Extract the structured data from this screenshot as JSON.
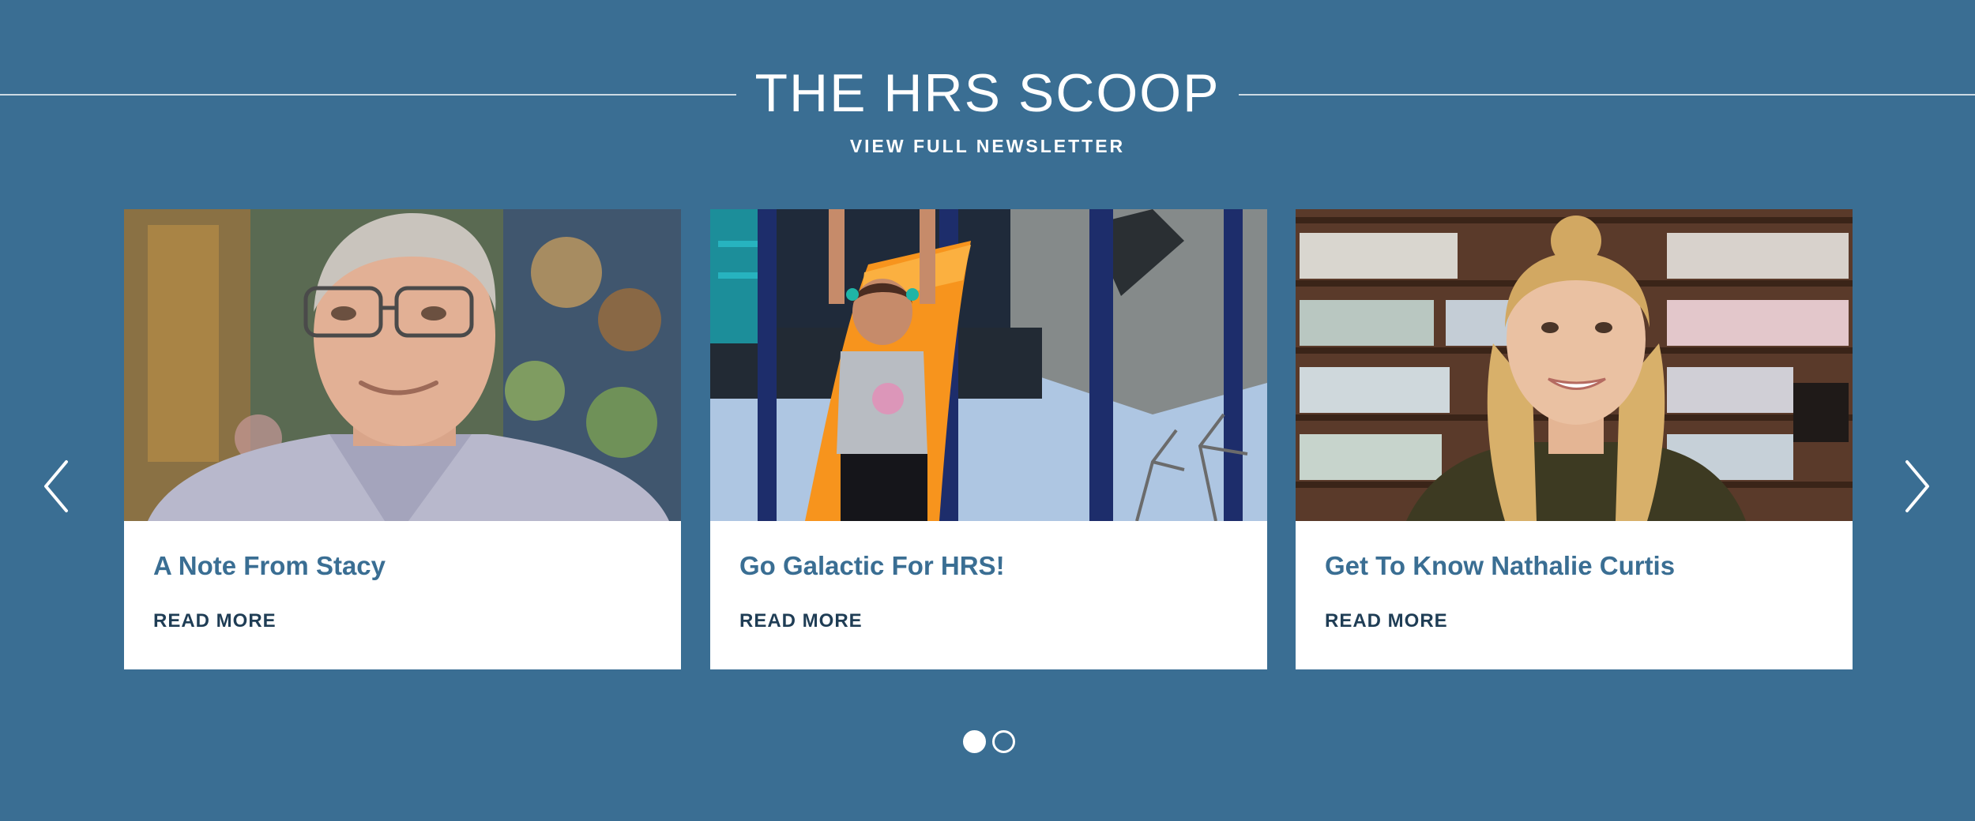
{
  "header": {
    "title": "THE HRS SCOOP",
    "newsletter_link": "VIEW FULL NEWSLETTER"
  },
  "carousel": {
    "prev_icon": "chevron-left-icon",
    "next_icon": "chevron-right-icon",
    "cards": [
      {
        "title": "A Note From Stacy",
        "read_more": "READ MORE",
        "image": "man-with-glasses-portrait"
      },
      {
        "title": "Go Galactic For HRS!",
        "read_more": "READ MORE",
        "image": "girl-on-playground-slide"
      },
      {
        "title": "Get To Know Nathalie Curtis",
        "read_more": "READ MORE",
        "image": "woman-in-library-portrait"
      }
    ],
    "pagination": {
      "total_pages": 2,
      "active_page": 1
    }
  },
  "colors": {
    "background": "#3a6e93",
    "card_title": "#3a6e93",
    "read_more": "#1f3d55",
    "card_background": "#ffffff"
  }
}
